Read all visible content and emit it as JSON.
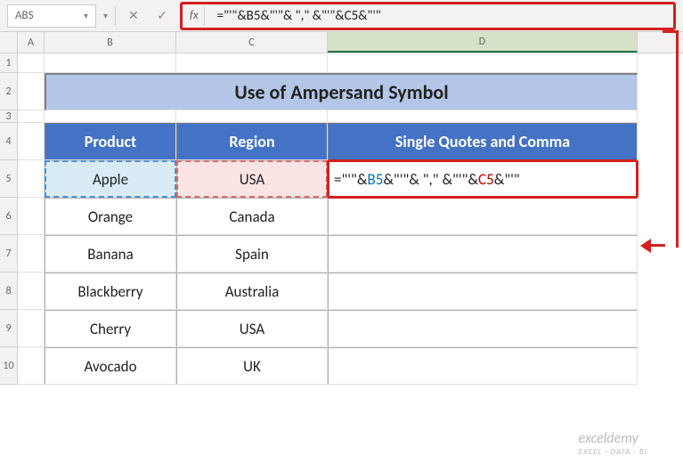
{
  "nameBox": "ABS",
  "fxLabel": "fx",
  "formulaBarText": "=\"'\"&B5&\"'\"& \",\" &\"'\"&C5&\"'\"",
  "columns": [
    "A",
    "B",
    "C",
    "D"
  ],
  "rows": [
    "1",
    "2",
    "3",
    "4",
    "5",
    "6",
    "7",
    "8",
    "9",
    "10"
  ],
  "title": "Use of Ampersand Symbol",
  "headers": {
    "product": "Product",
    "region": "Region",
    "result": "Single Quotes and Comma"
  },
  "data": [
    {
      "product": "Apple",
      "region": "USA"
    },
    {
      "product": "Orange",
      "region": "Canada"
    },
    {
      "product": "Banana",
      "region": "Spain"
    },
    {
      "product": "Blackberry",
      "region": "Australia"
    },
    {
      "product": "Cherry",
      "region": "USA"
    },
    {
      "product": "Avocado",
      "region": "UK"
    }
  ],
  "cellFormula": {
    "prefix": "=\"'\"&",
    "refB": "B5",
    "mid1": "&\"'\"& \",\" &\"'\"&",
    "refC": "C5",
    "suffix": "&\"'\""
  },
  "icons": {
    "cancel": "✕",
    "confirm": "✓",
    "chevron": "▾"
  },
  "watermark": "exceldemy",
  "watermarkSub": "EXCEL · DATA · BI"
}
